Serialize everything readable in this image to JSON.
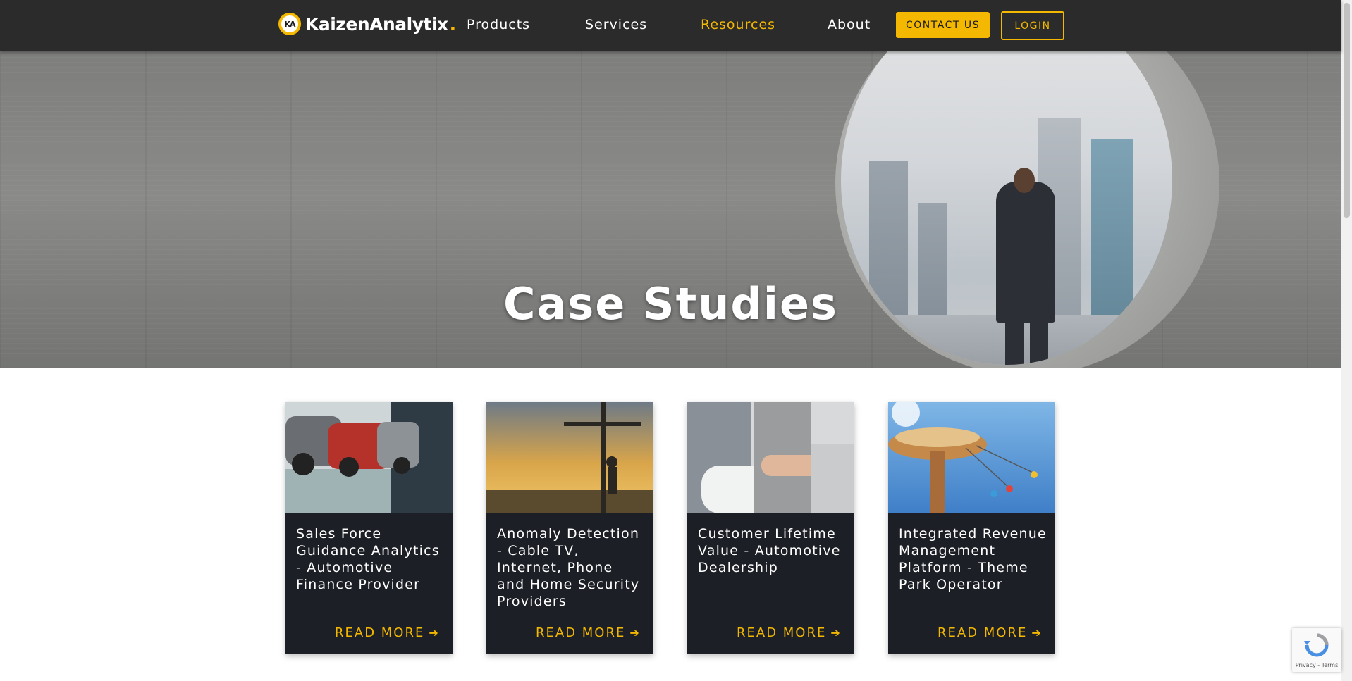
{
  "header": {
    "logo_text": "KaizenAnalytix",
    "logo_mark": "KA",
    "nav": [
      {
        "label": "Products"
      },
      {
        "label": "Services"
      },
      {
        "label": "Resources"
      },
      {
        "label": "About"
      }
    ],
    "active_nav": "Resources",
    "contact_label": "CONTACT US",
    "login_label": "LOGIN"
  },
  "hero": {
    "title": "Case Studies"
  },
  "cards": [
    {
      "title": "Sales Force Guidance Analytics - Automotive Finance Provider",
      "cta": "READ MORE",
      "image": "car-showroom-photo"
    },
    {
      "title": "Anomaly Detection - Cable TV, Internet, Phone and Home Security Providers",
      "cta": "READ MORE",
      "image": "utility-pole-worker-sunset-photo"
    },
    {
      "title": "Customer Lifetime Value - Automotive Dealership",
      "cta": "READ MORE",
      "image": "handshake-photo"
    },
    {
      "title": "Integrated Revenue Management Platform - Theme Park Operator",
      "cta": "READ MORE",
      "image": "swing-carousel-photo"
    }
  ],
  "recaptcha": {
    "text": "Privacy - Terms"
  },
  "colors": {
    "accent": "#f5b800",
    "header_bg": "#2b2b2b",
    "card_bg": "#1c1f26"
  }
}
